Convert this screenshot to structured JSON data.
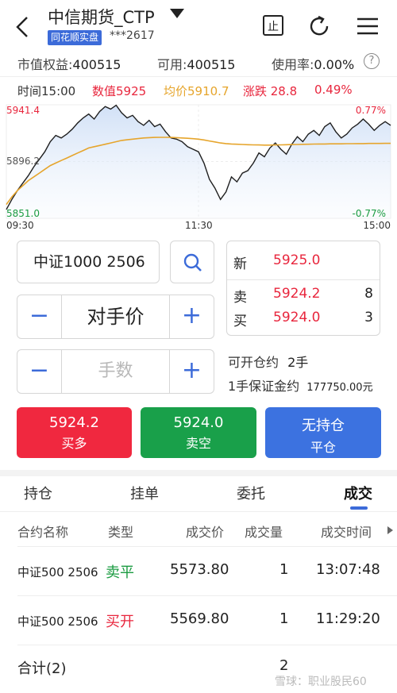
{
  "header": {
    "title": "中信期货_CTP",
    "badge": "同花顺实盘",
    "account": "***2617"
  },
  "account_row": {
    "equity_label": "市值权益:",
    "equity_value": "400515",
    "available_label": "可用:",
    "available_value": "400515",
    "usage_label": "使用率:",
    "usage_value": "0.00%",
    "help": "?"
  },
  "info_row": {
    "time": "时间15:00",
    "value": "数值5925",
    "avg": "均价5910.7",
    "change": "涨跌 28.8",
    "pct": "0.49%"
  },
  "chart_data": {
    "type": "line",
    "y_high_label": "5941.4",
    "y_mid_label": "5896.2",
    "y_low_label": "5851.0",
    "pct_high_label": "0.77%",
    "pct_low_label": "-0.77%",
    "time_labels": [
      "09:30",
      "11:30",
      "15:00"
    ],
    "ylim": [
      5851.0,
      5941.4
    ],
    "reference": 5896.2,
    "series": [
      {
        "values": [
          5858,
          5866,
          5873,
          5879,
          5885,
          5892,
          5898,
          5904,
          5912,
          5917,
          5915,
          5918,
          5922,
          5927,
          5931,
          5934,
          5930,
          5936,
          5940,
          5938,
          5941,
          5935,
          5931,
          5933,
          5928,
          5925,
          5929,
          5924,
          5926,
          5920,
          5915,
          5914,
          5912,
          5908,
          5906,
          5904,
          5895,
          5882,
          5875,
          5866,
          5872,
          5884,
          5880,
          5887,
          5889,
          5895,
          5903,
          5900,
          5907,
          5911,
          5906,
          5902,
          5910,
          5916,
          5912,
          5918,
          5921,
          5917,
          5924,
          5927,
          5920,
          5915,
          5918,
          5923,
          5926,
          5930,
          5926,
          5921,
          5925,
          5928,
          5925
        ]
      },
      {
        "values": [
          5862,
          5868,
          5873,
          5877,
          5881,
          5884,
          5887,
          5890,
          5893,
          5895,
          5897,
          5899,
          5901,
          5903,
          5905,
          5907,
          5908,
          5909,
          5910,
          5911,
          5912,
          5913,
          5913.5,
          5914,
          5914.5,
          5915,
          5915.2,
          5915.4,
          5915.5,
          5915.5,
          5915.4,
          5915.2,
          5915,
          5914.7,
          5914.4,
          5914,
          5913.4,
          5912.6,
          5911.8,
          5911,
          5910.5,
          5910.2,
          5910,
          5909.8,
          5909.6,
          5909.5,
          5909.4,
          5909.3,
          5909.3,
          5909.4,
          5909.5,
          5909.6,
          5909.7,
          5909.8,
          5909.9,
          5910,
          5910.1,
          5910.2,
          5910.2,
          5910.3,
          5910.3,
          5910.3,
          5910.4,
          5910.4,
          5910.5,
          5910.5,
          5910.6,
          5910.6,
          5910.6,
          5910.7,
          5910.7
        ]
      }
    ]
  },
  "order": {
    "symbol": "中证1000 2506",
    "price_mode": "对手价",
    "qty_placeholder": "手数",
    "minus": "−",
    "plus": "+",
    "can_open_label": "可开仓约",
    "can_open_value": "2手",
    "margin_label": "1手保证金约",
    "margin_value": "177750.00元"
  },
  "quote": {
    "last_label": "新",
    "last_value": "5925.0",
    "ask_label": "卖",
    "ask_price": "5924.2",
    "ask_qty": "8",
    "bid_label": "买",
    "bid_price": "5924.0",
    "bid_qty": "3"
  },
  "buttons": {
    "buy_price": "5924.2",
    "buy_label": "买多",
    "sell_price": "5924.0",
    "sell_label": "卖空",
    "close_top": "无持仓",
    "close_label": "平仓"
  },
  "tabs": [
    "持仓",
    "挂单",
    "委托",
    "成交"
  ],
  "table": {
    "headers": [
      "合约名称",
      "类型",
      "成交价",
      "成交量",
      "成交时间"
    ],
    "rows": [
      {
        "name": "中证500 2506",
        "type": "卖平",
        "price": "5573.80",
        "qty": "1",
        "time": "13:07:48"
      },
      {
        "name": "中证500 2506",
        "type": "买开",
        "price": "5569.80",
        "qty": "1",
        "time": "11:29:20"
      }
    ],
    "total_label": "合计(2)",
    "total_qty": "2"
  },
  "watermark": "雪球：职业股民60",
  "colors": {
    "red": "#e8263d",
    "green": "#1a9b40",
    "blue": "#3c6bd9",
    "orange": "#e6a52c",
    "grey_text": "#9a9a9a"
  }
}
